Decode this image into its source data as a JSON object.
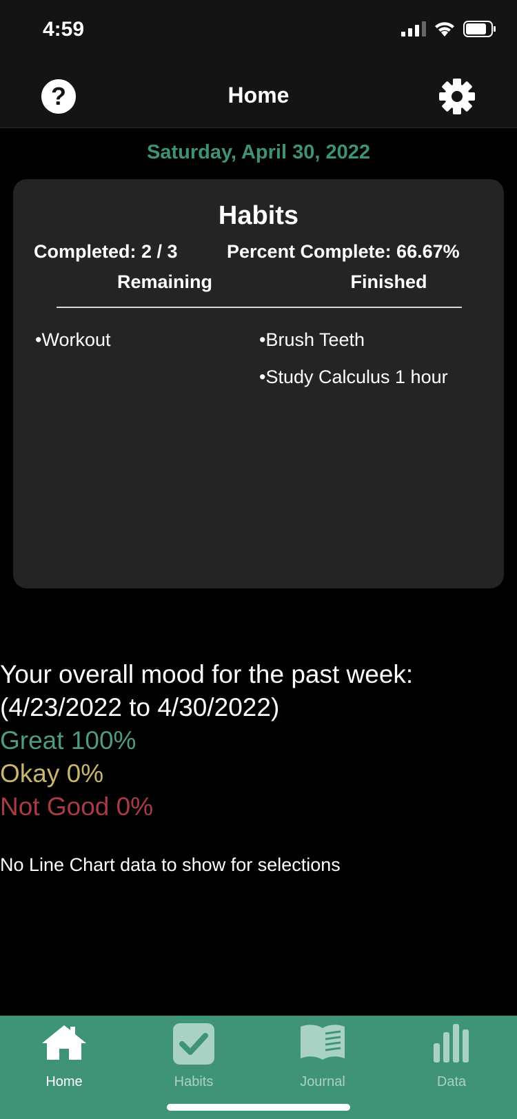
{
  "status": {
    "time": "4:59"
  },
  "header": {
    "title": "Home",
    "help_label": "?",
    "help_icon": "question-circle-icon",
    "settings_icon": "gear-icon"
  },
  "date": "Saturday, April 30, 2022",
  "habits_card": {
    "title": "Habits",
    "completed": "Completed: 2 / 3",
    "percent": "Percent Complete: 66.67%",
    "remaining_header": "Remaining",
    "finished_header": "Finished",
    "remaining": [
      "•Workout"
    ],
    "finished": [
      "•Brush Teeth",
      "•Study Calculus 1 hour"
    ]
  },
  "mood": {
    "heading": "Your overall mood for the past week:",
    "range": "(4/23/2022 to 4/30/2022)",
    "great": "Great 100%",
    "okay": "Okay 0%",
    "not_good": "Not Good 0%"
  },
  "line_chart_message": "No Line Chart data to show for selections",
  "colors": {
    "accent": "#3e9276",
    "great": "#4f9b7e",
    "okay": "#c9b66a",
    "not_good": "#a93a46",
    "tab_bar": "#3f9478"
  },
  "tabs": [
    {
      "label": "Home",
      "icon": "house-icon",
      "active": true
    },
    {
      "label": "Habits",
      "icon": "checkbox-icon",
      "active": false
    },
    {
      "label": "Journal",
      "icon": "book-icon",
      "active": false
    },
    {
      "label": "Data",
      "icon": "bar-chart-icon",
      "active": false
    }
  ]
}
